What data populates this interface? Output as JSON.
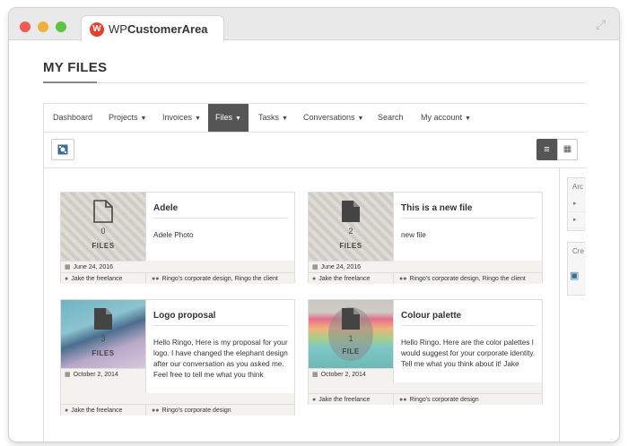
{
  "window": {
    "tab_logo": "W",
    "tab_title_prefix": "WP",
    "tab_title_bold": "CustomerArea"
  },
  "page": {
    "title": "MY FILES"
  },
  "nav": [
    {
      "label": "Dashboard",
      "dropdown": false,
      "active": false
    },
    {
      "label": "Projects",
      "dropdown": true,
      "active": false
    },
    {
      "label": "Invoices",
      "dropdown": true,
      "active": false
    },
    {
      "label": "Files",
      "dropdown": true,
      "active": true
    },
    {
      "label": "Tasks",
      "dropdown": true,
      "active": false
    },
    {
      "label": "Conversations",
      "dropdown": true,
      "active": false
    },
    {
      "label": "Search",
      "dropdown": false,
      "active": false
    },
    {
      "label": "My account",
      "dropdown": true,
      "active": false
    }
  ],
  "sidebar": {
    "archives_title": "Arc",
    "create_title": "Cre"
  },
  "cards": [
    {
      "title": "Adele",
      "description": "Adele Photo",
      "count": "0",
      "count_label": "FILES",
      "date": "June 24, 2016",
      "owner": "Jake the freelance",
      "projects": "Ringo's corporate design, Ringo the client"
    },
    {
      "title": "This is a new file",
      "description": "new file",
      "count": "2",
      "count_label": "FILES",
      "date": "June 24, 2016",
      "owner": "Jake the freelance",
      "projects": "Ringo's corporate design, Ringo the client"
    },
    {
      "title": "Logo proposal",
      "description": "Hello Ringo, Here is my proposal for your logo. I have changed the elephant design after our conversation as you asked me. Feel free to tell me what you think",
      "count": "3",
      "count_label": "FILES",
      "date": "October 2, 2014",
      "owner": "Jake the freelance",
      "projects": "Ringo's corporate design"
    },
    {
      "title": "Colour palette",
      "description": "Hello Ringo. Here are the color palettes I would suggest for your corporate identity. Tell me what you think about it! Jake",
      "count": "1",
      "count_label": "FILE",
      "date": "October 2, 2014",
      "owner": "Jake the freelance",
      "projects": "Ringo's corporate design"
    }
  ]
}
